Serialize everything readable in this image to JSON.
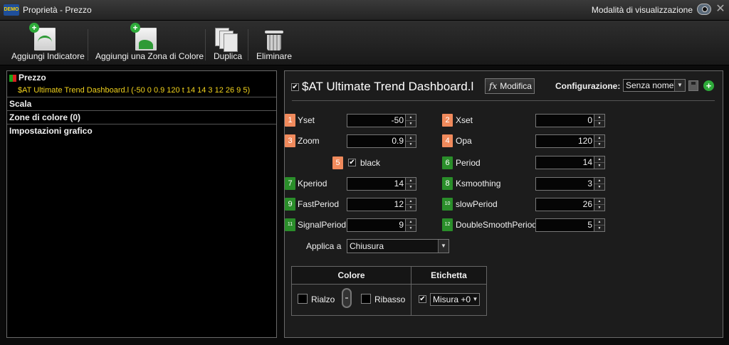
{
  "window": {
    "title": "Proprietà - Prezzo",
    "view_mode": "Modalità di visualizzazione",
    "logo_text": "DEMO"
  },
  "toolbar": {
    "add_indicator": "Aggiungi Indicatore",
    "add_color_zone": "Aggiungi una Zona di Colore",
    "duplicate": "Duplica",
    "delete": "Eliminare"
  },
  "tree": {
    "prezzo": "Prezzo",
    "indicator_item": "$AT Ultimate Trend Dashboard.l (-50 0 0.9 120 t 14 14 3 12 26 9 5)",
    "scala": "Scala",
    "zone": "Zone di colore (0)",
    "grafico": "Impostazioni grafico"
  },
  "indicator": {
    "name": "$AT Ultimate Trend Dashboard.l",
    "enabled": "✔",
    "modifica": "Modifica",
    "modifica_icon": "fx",
    "config_label": "Configurazione:",
    "config_value": "Senza nome*"
  },
  "params": [
    {
      "num": "1",
      "label": "Yset",
      "value": "-50"
    },
    {
      "num": "2",
      "label": "Xset",
      "value": "0"
    },
    {
      "num": "3",
      "label": "Zoom",
      "value": "0.9"
    },
    {
      "num": "4",
      "label": "Opa",
      "value": "120"
    },
    {
      "num": "5",
      "label": "black",
      "value": "✔"
    },
    {
      "num": "6",
      "label": "Period",
      "value": "14"
    },
    {
      "num": "7",
      "label": "Kperiod",
      "value": "14"
    },
    {
      "num": "8",
      "label": "Ksmoothing",
      "value": "3"
    },
    {
      "num": "9",
      "label": "FastPeriod",
      "value": "12"
    },
    {
      "num": "10",
      "label": "slowPeriod",
      "value": "26"
    },
    {
      "num": "11",
      "label": "SignalPeriod",
      "value": "9"
    },
    {
      "num": "12",
      "label": "DoubleSmoothPeriod",
      "value": "5"
    }
  ],
  "apply": {
    "label": "Applica a",
    "value": "Chiusura"
  },
  "style_table": {
    "colore_header": "Colore",
    "etichetta_header": "Etichetta",
    "rialzo": "Rialzo",
    "ribasso": "Ribasso",
    "label_value": "Misura +0",
    "label_checked": "✔"
  },
  "colors": {
    "orange_badge": "#f08a5c",
    "green_badge": "#2a8e2a",
    "highlight_text": "#f1d21c"
  }
}
